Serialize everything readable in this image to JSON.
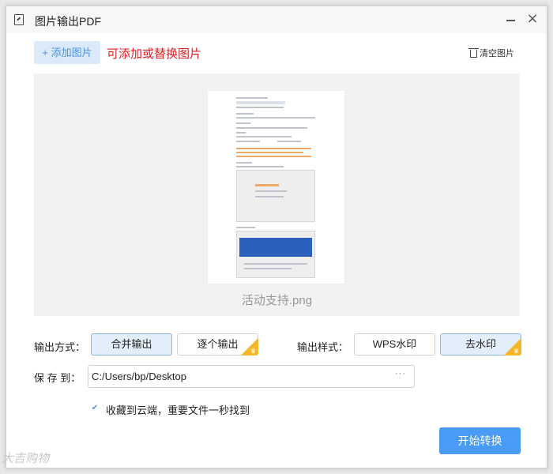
{
  "window": {
    "title": "图片输出PDF",
    "icon": "pdf-doc-icon",
    "minimize_glyph": "",
    "close_glyph": "×"
  },
  "toolbar": {
    "add_label": "+ 添加图片",
    "hint": "可添加或替换图片",
    "clear_label": "清空图片",
    "clear_icon": "trash-icon"
  },
  "preview": {
    "file_name": "活动支持.png"
  },
  "output_mode": {
    "label": "输出方式：",
    "options": [
      {
        "label": "合并输出",
        "selected": true,
        "premium": false
      },
      {
        "label": "逐个输出",
        "selected": false,
        "premium": true
      }
    ]
  },
  "output_style": {
    "label": "输出样式：",
    "options": [
      {
        "label": "WPS水印",
        "selected": false,
        "premium": false
      },
      {
        "label": "去水印",
        "selected": true,
        "premium": true
      }
    ]
  },
  "save": {
    "label": "保 存 到：",
    "path": "C:/Users/bp/Desktop",
    "more_glyph": "···"
  },
  "cloud": {
    "checked": true,
    "check_glyph": "✔",
    "label": "收藏到云端，重要文件一秒找到"
  },
  "actions": {
    "start_label": "开始转换"
  },
  "watermark": {
    "text": "大吉购物"
  },
  "colors": {
    "accent": "#4a9bf5",
    "hint_red": "#e02020",
    "premium_gold": "#f5b629",
    "selected_bg": "#e3eefb"
  }
}
